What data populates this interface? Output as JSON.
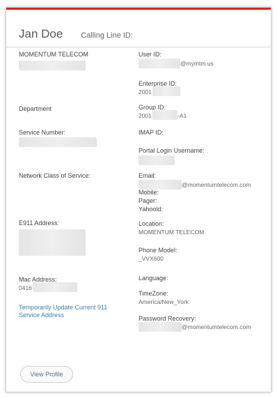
{
  "header": {
    "name": "Jan Doe",
    "calling_line_label": "Calling Line ID:"
  },
  "left": {
    "company": "MOMENTUM TELECOM",
    "department_label": "Department",
    "service_number_label": "Service Number:",
    "ncos_label": "Network Class of Service:",
    "e911_label": "E911 Address:",
    "mac_label": "Mac Address:",
    "mac_value": "0416",
    "temp_link": "Temporarily Update Current 911 Service Address"
  },
  "right": {
    "user_id_label": "User ID:",
    "user_id_value": "@mymtm.us",
    "enterprise_label": "Enterprise ID:",
    "enterprise_value": "2001",
    "group_label": "Group ID:",
    "group_value_prefix": "2001",
    "group_value_suffix": "-A1",
    "imap_label": "IMAP ID:",
    "portal_label": "Portal Login Username:",
    "email_label": "Email:",
    "email_value": "@momentumtelecom.com",
    "mobile_label": "Mobile:",
    "pager_label": "Pager:",
    "yahoo_label": "Yahoold:",
    "location_label": "Location:",
    "location_value": "MOMENTUM TELECOM",
    "phone_model_label": "Phone Model:",
    "phone_model_value": "_VVX600",
    "language_label": "Language:",
    "timezone_label": "TimeZone:",
    "timezone_value": "America/New_York",
    "pw_recovery_label": "Password Recovery:",
    "pw_recovery_value": "@momentumtelecom.com"
  },
  "actions": {
    "view_profile": "View Profile"
  }
}
